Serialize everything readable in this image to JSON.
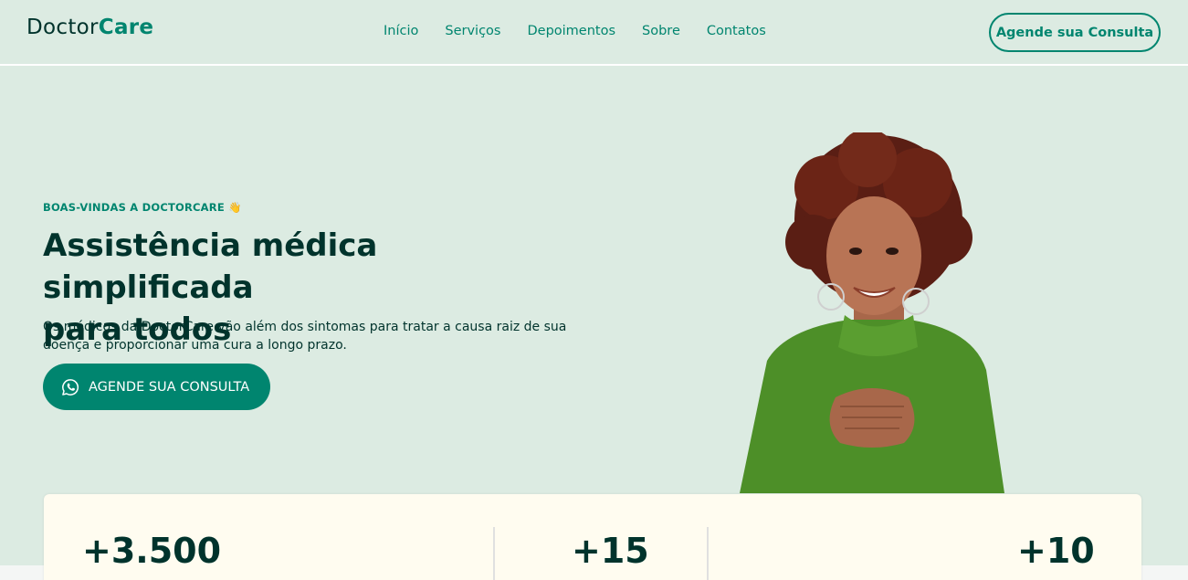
{
  "header": {
    "logo_part1": "Doctor",
    "logo_part2": "Care",
    "nav": [
      "Início",
      "Serviços",
      "Depoimentos",
      "Sobre",
      "Contatos"
    ],
    "cta_label": "Agende sua Consulta"
  },
  "hero": {
    "eyebrow": "BOAS-VINDAS A DOCTORCARE 👋",
    "title_line1": "Assistência médica simplificada",
    "title_line2": "para todos",
    "description": "Os médicos da DoctorCare vão além dos sintomas para tratar a causa raiz de sua doença e proporcionar uma cura a longo prazo.",
    "cta_label": "AGENDE SUA CONSULTA",
    "cta_icon": "whatsapp-icon"
  },
  "stats": [
    {
      "value": "+3.500"
    },
    {
      "value": "+15"
    },
    {
      "value": "+10"
    }
  ],
  "colors": {
    "brand": "#00856f",
    "dark": "#00332c",
    "background": "#dcebe2",
    "card": "#fffcf0"
  }
}
